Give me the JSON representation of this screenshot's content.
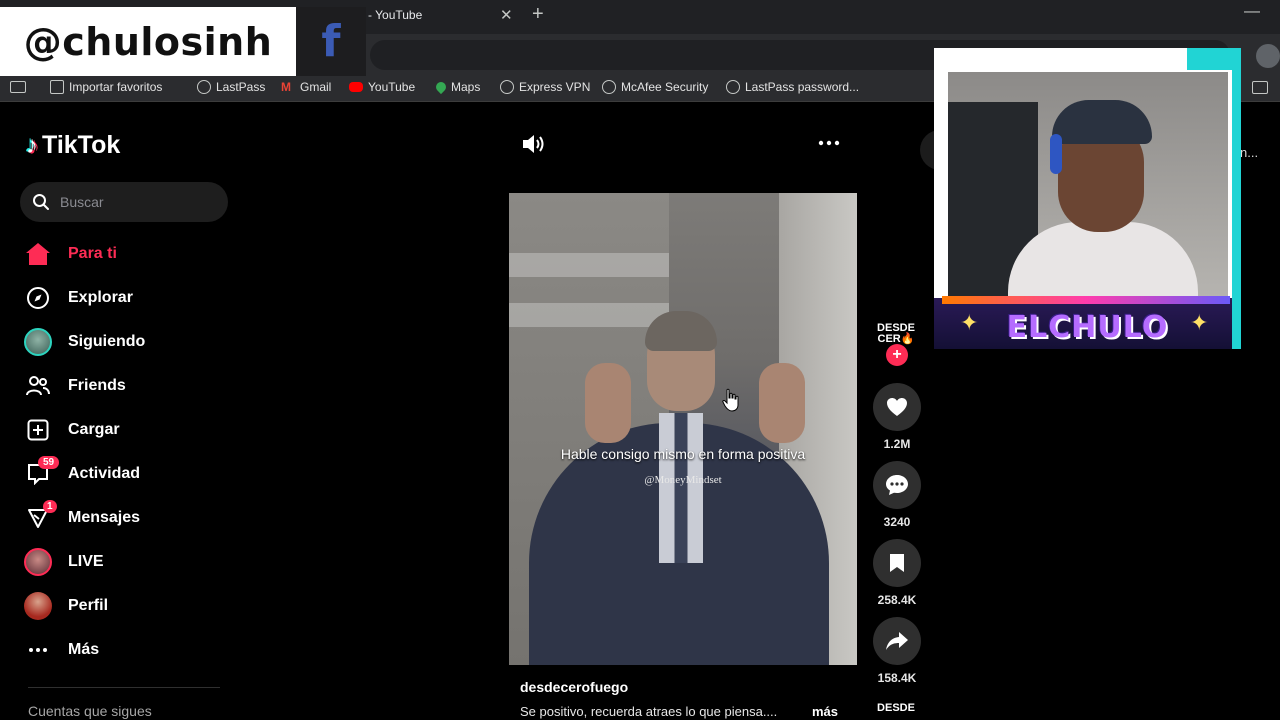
{
  "browser": {
    "tab_title": "- YouTube",
    "close_glyph": "✕",
    "new_tab_glyph": "+",
    "minimize_glyph": "—",
    "bookmarks": [
      {
        "label": "Importar favoritos",
        "icon": "import-icon"
      },
      {
        "label": "LastPass",
        "icon": "globe-icon"
      },
      {
        "label": "Gmail",
        "icon": "gmail-icon"
      },
      {
        "label": "YouTube",
        "icon": "youtube-icon"
      },
      {
        "label": "Maps",
        "icon": "maps-icon"
      },
      {
        "label": "Express VPN",
        "icon": "globe-icon"
      },
      {
        "label": "McAfee Security",
        "icon": "globe-icon"
      },
      {
        "label": "LastPass password...",
        "icon": "globe-icon"
      }
    ]
  },
  "overlay": {
    "handle": "@chulosinh",
    "fb_letter": "f",
    "cam_title": "ELCHULO"
  },
  "tiktok": {
    "logo_text": "TikTok",
    "search_placeholder": "Buscar",
    "nav": [
      {
        "label": "Para ti",
        "icon": "home-icon",
        "active": true
      },
      {
        "label": "Explorar",
        "icon": "compass-icon"
      },
      {
        "label": "Siguiendo",
        "icon": "following-avatar"
      },
      {
        "label": "Friends",
        "icon": "friends-icon"
      },
      {
        "label": "Cargar",
        "icon": "upload-icon"
      },
      {
        "label": "Actividad",
        "icon": "activity-icon",
        "badge": "59"
      },
      {
        "label": "Mensajes",
        "icon": "messages-icon",
        "badge": "1"
      },
      {
        "label": "LIVE",
        "icon": "live-avatar"
      },
      {
        "label": "Perfil",
        "icon": "profile-avatar"
      },
      {
        "label": "Más",
        "icon": "more-icon"
      }
    ],
    "following_title": "Cuentas que sigues",
    "video": {
      "caption": "Hable consigo mismo en forma positiva",
      "watermark": "@MoneyMindset",
      "author": "desdecerofuego",
      "description": "Se positivo, recuerda atraes lo que piensa....",
      "more_label": "más",
      "creator_badge_line1": "DESDE",
      "creator_badge_line2": "CER🔥",
      "next_creator": "DESDE"
    },
    "actions": {
      "likes": "1.2M",
      "comments": "3240",
      "saves": "258.4K",
      "shares": "158.4K"
    },
    "side_peek_text": "n..."
  },
  "colors": {
    "accent": "#fe2c55",
    "background": "#000000",
    "chrome": "#202124"
  }
}
